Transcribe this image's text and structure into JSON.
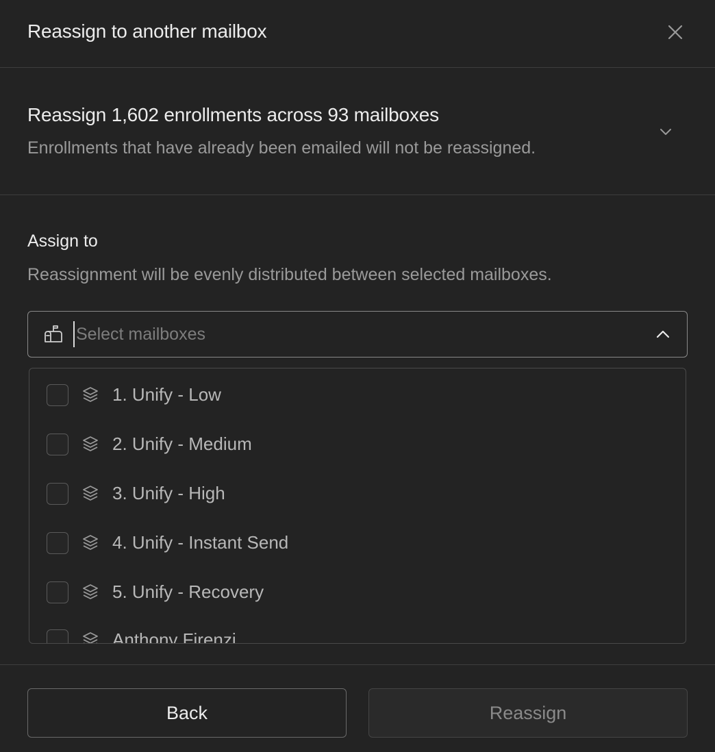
{
  "header": {
    "title": "Reassign to another mailbox",
    "close_icon": "close-icon"
  },
  "summary": {
    "title": "Reassign 1,602 enrollments across 93 mailboxes",
    "subtitle": "Enrollments that have already been emailed will not be reassigned.",
    "expand_icon": "chevron-down-icon"
  },
  "assign": {
    "label": "Assign to",
    "description": "Reassignment will be evenly distributed between selected mailboxes.",
    "select": {
      "placeholder": "Select mailboxes",
      "value": "",
      "icon": "mailbox-icon",
      "toggle_icon": "chevron-up-icon"
    },
    "options": [
      {
        "label": "1. Unify - Low",
        "checked": false,
        "icon": "layers-icon"
      },
      {
        "label": "2. Unify - Medium",
        "checked": false,
        "icon": "layers-icon"
      },
      {
        "label": "3. Unify - High",
        "checked": false,
        "icon": "layers-icon"
      },
      {
        "label": "4. Unify - Instant Send",
        "checked": false,
        "icon": "layers-icon"
      },
      {
        "label": "5. Unify - Recovery",
        "checked": false,
        "icon": "layers-icon"
      },
      {
        "label": "Anthony Firenzi",
        "checked": false,
        "icon": "layers-icon"
      }
    ]
  },
  "footer": {
    "back_label": "Back",
    "reassign_label": "Reassign"
  },
  "colors": {
    "background": "#232323",
    "divider": "#3d3d3d",
    "text_primary": "#ececec",
    "text_secondary": "#9a9a9a",
    "disabled_text": "#8a8a8a"
  }
}
